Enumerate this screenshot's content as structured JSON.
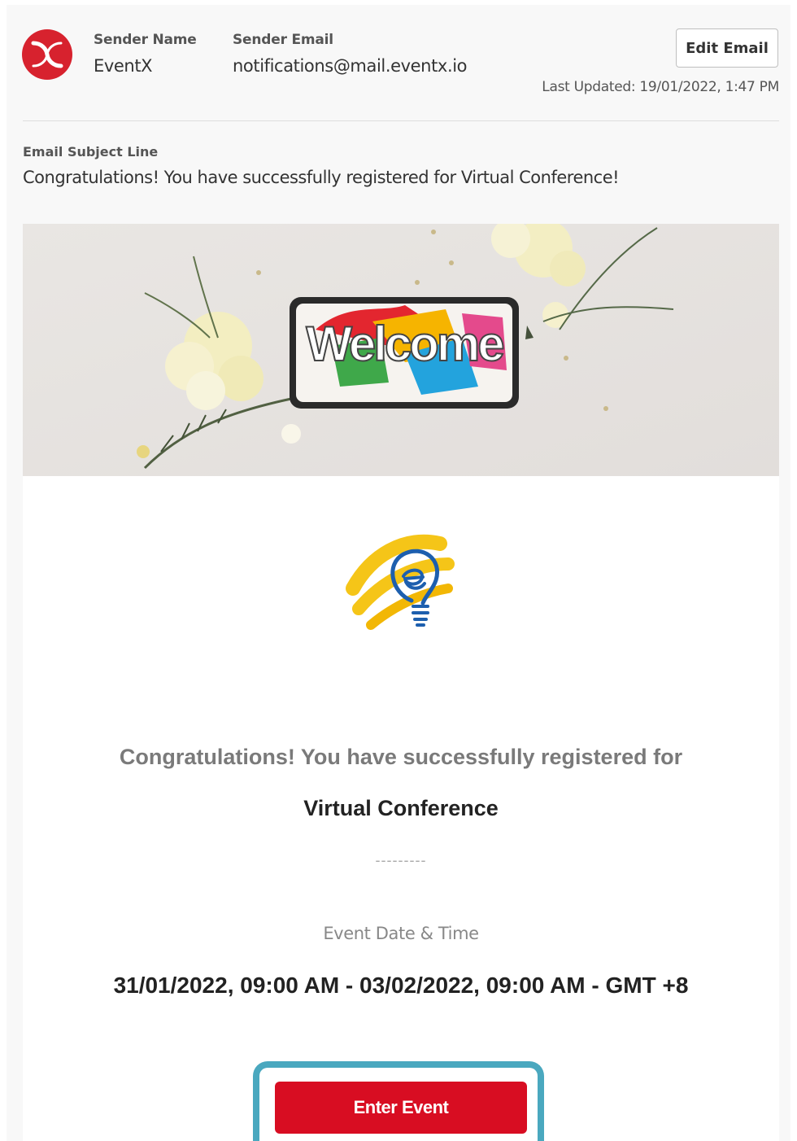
{
  "header": {
    "sender_name_label": "Sender Name",
    "sender_name": "EventX",
    "sender_email_label": "Sender Email",
    "sender_email": "notifications@mail.eventx.io",
    "edit_button": "Edit Email",
    "last_updated": "Last Updated: 19/01/2022, 1:47 PM"
  },
  "subject": {
    "label": "Email Subject Line",
    "value": "Congratulations! You have successfully registered for Virtual Conference!"
  },
  "email": {
    "banner_text": "Welcome",
    "congrats_text": "Congratulations! You have successfully registered for",
    "event_name": "Virtual Conference",
    "divider_text": "---------",
    "date_label": "Event Date & Time",
    "date_value": "31/01/2022, 09:00 AM - 03/02/2022, 09:00 AM - GMT +8",
    "enter_button": "Enter Event"
  },
  "colors": {
    "brand_red": "#d7222e",
    "button_red": "#d80d22",
    "highlight_teal": "#4aa8bf"
  },
  "icons": [
    "eventx-logo-icon",
    "lightbulb-logo-icon"
  ]
}
